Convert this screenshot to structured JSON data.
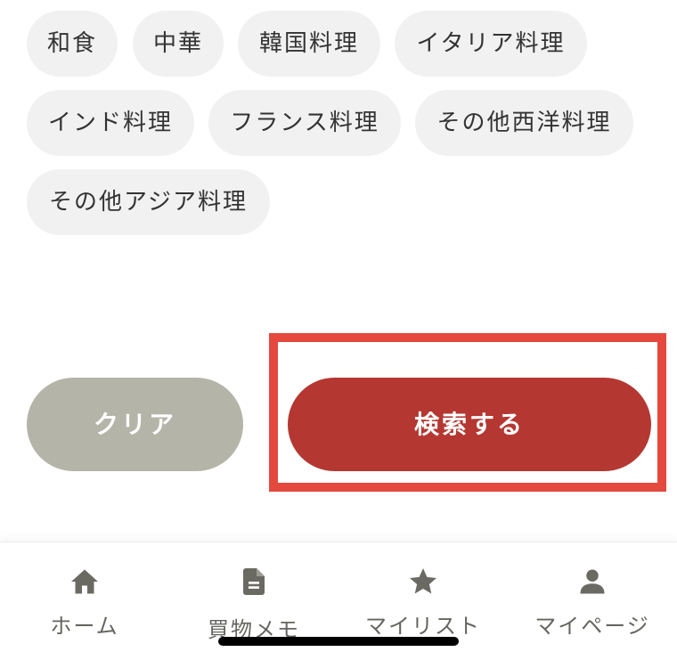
{
  "genres": [
    {
      "label": "和食"
    },
    {
      "label": "中華"
    },
    {
      "label": "韓国料理"
    },
    {
      "label": "イタリア料理"
    },
    {
      "label": "インド料理"
    },
    {
      "label": "フランス料理"
    },
    {
      "label": "その他西洋料理"
    },
    {
      "label": "その他アジア料理"
    }
  ],
  "actions": {
    "clear_label": "クリア",
    "search_label": "検索する"
  },
  "tabbar": {
    "items": [
      {
        "label": "ホーム",
        "icon": "home-icon"
      },
      {
        "label": "買物メモ",
        "icon": "document-icon"
      },
      {
        "label": "マイリスト",
        "icon": "star-icon"
      },
      {
        "label": "マイページ",
        "icon": "person-icon"
      }
    ]
  },
  "colors": {
    "chip_bg": "#f1f1f1",
    "clear_bg": "#b5b4a8",
    "search_bg": "#b53731",
    "highlight": "#e5483d",
    "tab_icon": "#6b6a62"
  }
}
